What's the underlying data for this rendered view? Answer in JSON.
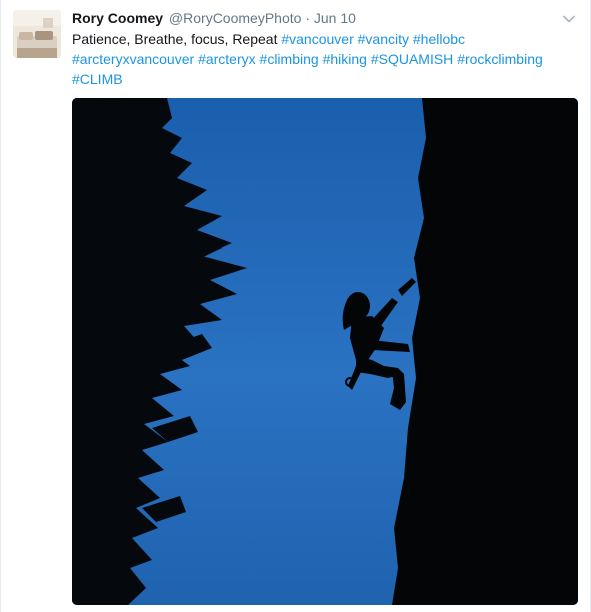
{
  "tweet": {
    "author": {
      "fullname": "Rory Coomey",
      "handle": "@RoryCoomeyPhoto"
    },
    "separator": "·",
    "timestamp": "Jun 10",
    "text_prefix": "Patience, Breathe, focus, Repeat ",
    "hashtags": [
      "#vancouver",
      "#vancity",
      "#hellobc",
      "#arcteryxvancouver",
      "#arcteryx",
      "#climbing",
      "#hiking",
      "#SQUAMISH",
      "#rockclimbing",
      "#CLIMB"
    ],
    "menu_icon": "chevron-down-icon",
    "colors": {
      "hashtag": "#1b95e0",
      "text": "#14171a",
      "secondary": "#657786",
      "sky": "#1d66b6"
    }
  }
}
